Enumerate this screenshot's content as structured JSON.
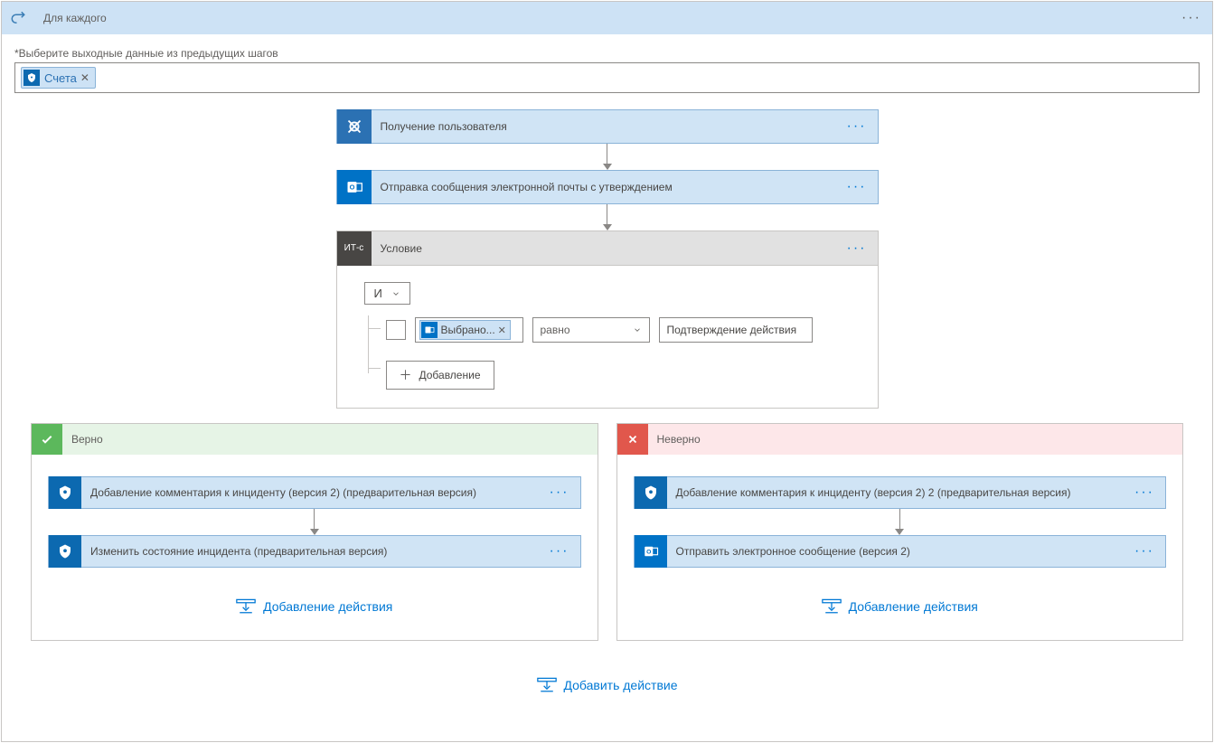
{
  "header": {
    "title": "Для каждого"
  },
  "input_section": {
    "label": "*Выберите выходные данные из предыдущих шагов",
    "token": "Счета"
  },
  "steps": {
    "get_user": "Получение пользователя",
    "send_approval": "Отправка сообщения электронной почты с утверждением"
  },
  "condition": {
    "label_prefix": "ИТ-с",
    "title": "Условие",
    "and_label": "И",
    "rule": {
      "left_token": "Выбрано...",
      "operator": "равно",
      "right_value": "Подтверждение действия"
    },
    "add_label": "Добавление"
  },
  "branches": {
    "true": {
      "title": "Верно",
      "step1": "Добавление комментария к инциденту (версия 2) (предварительная версия)",
      "step2": "Изменить состояние инцидента (предварительная версия)",
      "add_action": "Добавление действия"
    },
    "false": {
      "title": "Неверно",
      "step1": "Добавление комментария к инциденту (версия 2) 2 (предварительная версия)",
      "step2": "Отправить электронное сообщение (версия 2)",
      "add_action": "Добавление действия"
    }
  },
  "footer": {
    "add_action": "Добавить действие"
  }
}
